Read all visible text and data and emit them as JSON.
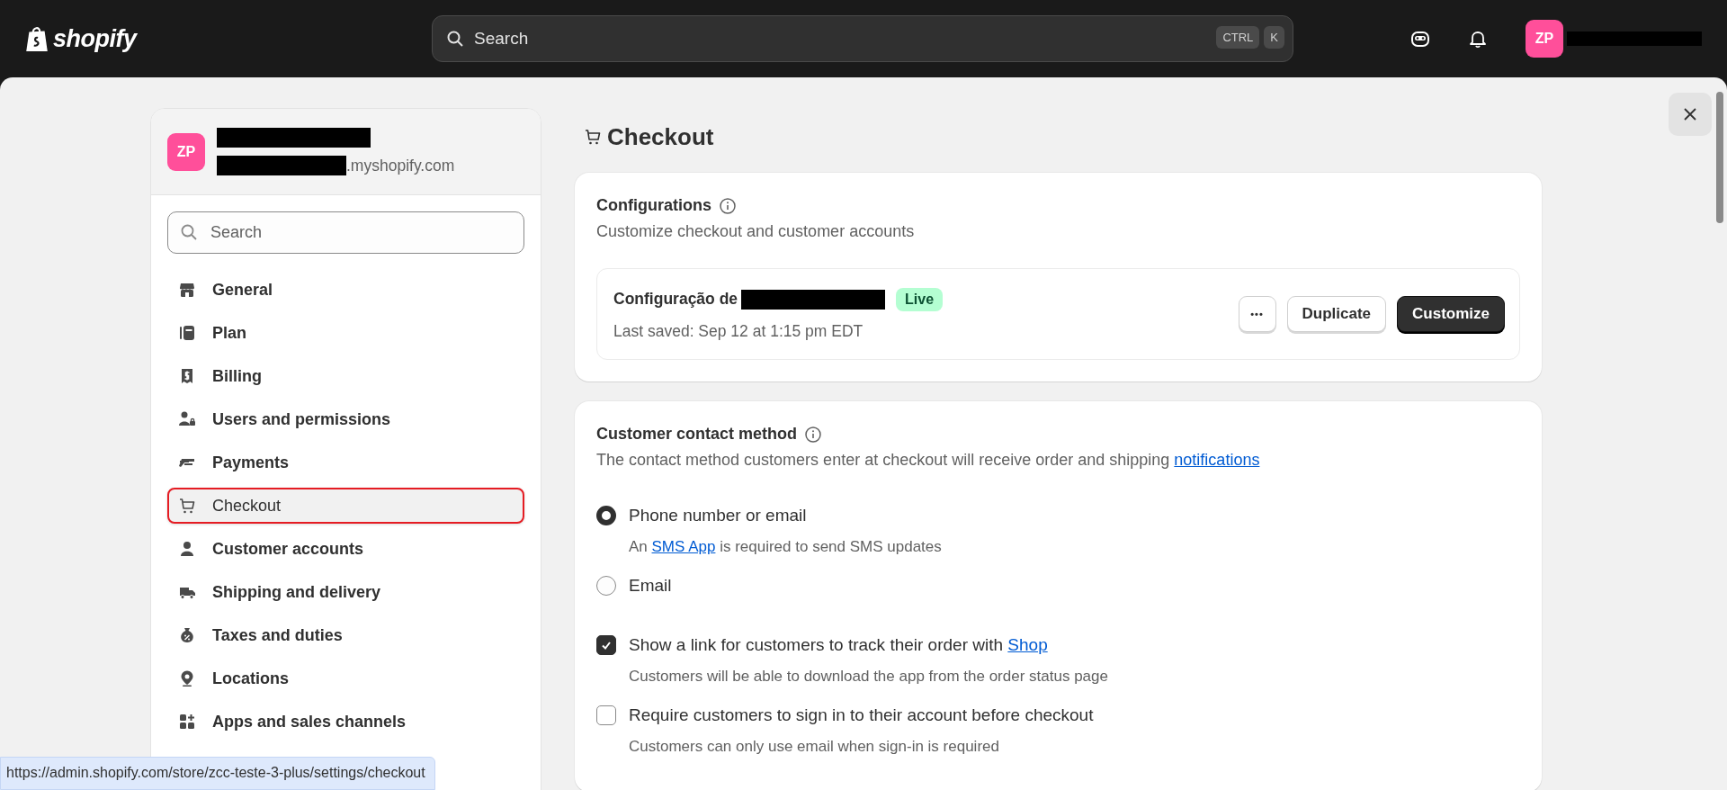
{
  "topbar": {
    "logo": "shopify",
    "search": {
      "placeholder": "Search"
    },
    "shortcut_keys": [
      "CTRL",
      "K"
    ],
    "account": {
      "initials": "ZP"
    }
  },
  "sidebar": {
    "store": {
      "initials": "ZP",
      "domain": ".myshopify.com"
    },
    "search": {
      "placeholder": "Search"
    },
    "items": [
      {
        "label": "General",
        "selected": false
      },
      {
        "label": "Plan",
        "selected": false
      },
      {
        "label": "Billing",
        "selected": false
      },
      {
        "label": "Users and permissions",
        "selected": false
      },
      {
        "label": "Payments",
        "selected": false
      },
      {
        "label": "Checkout",
        "selected": true
      },
      {
        "label": "Customer accounts",
        "selected": false
      },
      {
        "label": "Shipping and delivery",
        "selected": false
      },
      {
        "label": "Taxes and duties",
        "selected": false
      },
      {
        "label": "Locations",
        "selected": false
      },
      {
        "label": "Apps and sales channels",
        "selected": false
      }
    ]
  },
  "page": {
    "title": "Checkout",
    "configurations": {
      "title": "Configurations",
      "subtitle": "Customize checkout and customer accounts",
      "config": {
        "name": "Configuração de",
        "status": "Live",
        "saved": "Last saved: Sep 12 at 1:15 pm EDT"
      },
      "buttons": {
        "more": "•••",
        "duplicate": "Duplicate",
        "customize": "Customize"
      }
    },
    "contact": {
      "title": "Customer contact method",
      "description": "The contact method customers enter at checkout will receive order and shipping ",
      "description_link": "notifications",
      "options": [
        {
          "label": "Phone number or email",
          "selected": true,
          "hint_before": "An ",
          "hint_link": "SMS App",
          "hint_after": " is required to send SMS updates"
        },
        {
          "label": "Email",
          "selected": false
        }
      ],
      "checkboxes": [
        {
          "label": "Show a link for customers to track their order with ",
          "link": "Shop",
          "checked": true,
          "hint": "Customers will be able to download the app from the order status page"
        },
        {
          "label": "Require customers to sign in to their account before checkout",
          "checked": false,
          "hint": "Customers can only use email when sign-in is required"
        }
      ]
    }
  },
  "status_url": "https://admin.shopify.com/store/zcc-teste-3-plus/settings/checkout"
}
